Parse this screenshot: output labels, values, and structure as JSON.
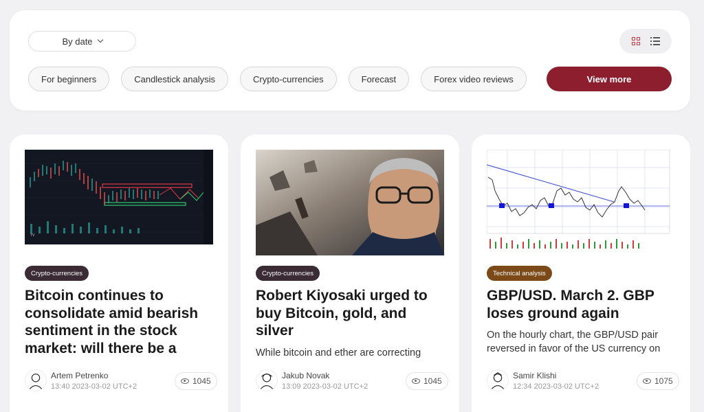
{
  "filters": {
    "sort_label": "By date",
    "categories": [
      "For beginners",
      "Candlestick analysis",
      "Crypto-currencies",
      "Forecast",
      "Forex video reviews"
    ],
    "view_more_label": "View more"
  },
  "articles": [
    {
      "badge": "Crypto-currencies",
      "badge_color": "#3a2b34",
      "title": "Bitcoin continues to consolidate amid bearish sentiment in the stock market: will there be a",
      "excerpt": "",
      "author": "Artem Petrenko",
      "datetime": "13:40 2023-03-02 UTC+2",
      "views": "1045"
    },
    {
      "badge": "Crypto-currencies",
      "badge_color": "#3a2b34",
      "title": "Robert Kiyosaki urged to buy Bitcoin, gold, and silver",
      "excerpt": "While bitcoin and ether are correcting",
      "author": "Jakub Novak",
      "datetime": "13:09 2023-03-02 UTC+2",
      "views": "1045"
    },
    {
      "badge": "Technical analysis",
      "badge_color": "#7b4a18",
      "title": "GBP/USD. March 2. GBP loses ground again",
      "excerpt": "On the hourly chart, the GBP/USD pair reversed in favor of the US currency on",
      "author": "Samir Klishi",
      "datetime": "12:34 2023-03-02 UTC+2",
      "views": "1075"
    }
  ],
  "icons": {
    "sort": "chevron-down-icon",
    "grid_view": "grid-view-icon",
    "list_view": "list-view-icon",
    "views": "eye-icon"
  },
  "colors": {
    "accent": "#8d1e2d",
    "grid_icon": "#c62f3a"
  }
}
